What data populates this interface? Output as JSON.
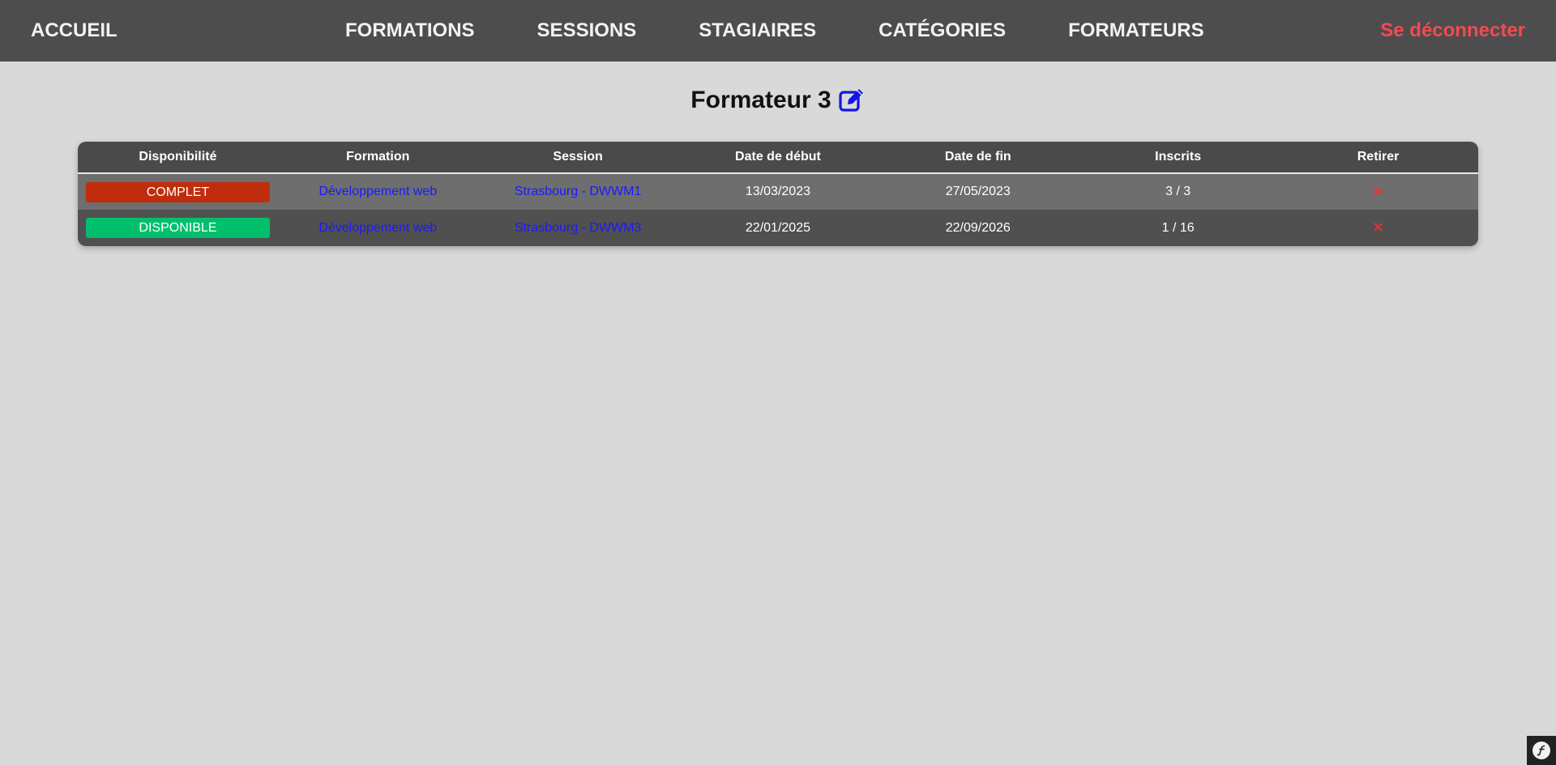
{
  "nav": {
    "home": "ACCUEIL",
    "links": [
      "FORMATIONS",
      "SESSIONS",
      "STAGIAIRES",
      "CATÉGORIES",
      "FORMATEURS"
    ],
    "logout": "Se déconnecter",
    "logout_color": "#ef4b55"
  },
  "page": {
    "title": "Formateur 3",
    "edit_icon": "edit-icon"
  },
  "table": {
    "headers": [
      "Disponibilité",
      "Formation",
      "Session",
      "Date de début",
      "Date de fin",
      "Inscrits",
      "Retirer"
    ],
    "rows": [
      {
        "status": "COMPLET",
        "status_color": "#c02d0c",
        "formation": "Développement web",
        "session": "Strasbourg - DWWM1",
        "start": "13/03/2023",
        "end": "27/05/2023",
        "enrolled": "3 / 3",
        "remove": "✕"
      },
      {
        "status": "DISPONIBLE",
        "status_color": "#00c06d",
        "formation": "Développement web",
        "session": "Strasbourg - DWWM3",
        "start": "22/01/2025",
        "end": "22/09/2026",
        "enrolled": "1 / 16",
        "remove": "✕"
      }
    ]
  },
  "toolbar": {
    "icon": "symfony-icon"
  }
}
